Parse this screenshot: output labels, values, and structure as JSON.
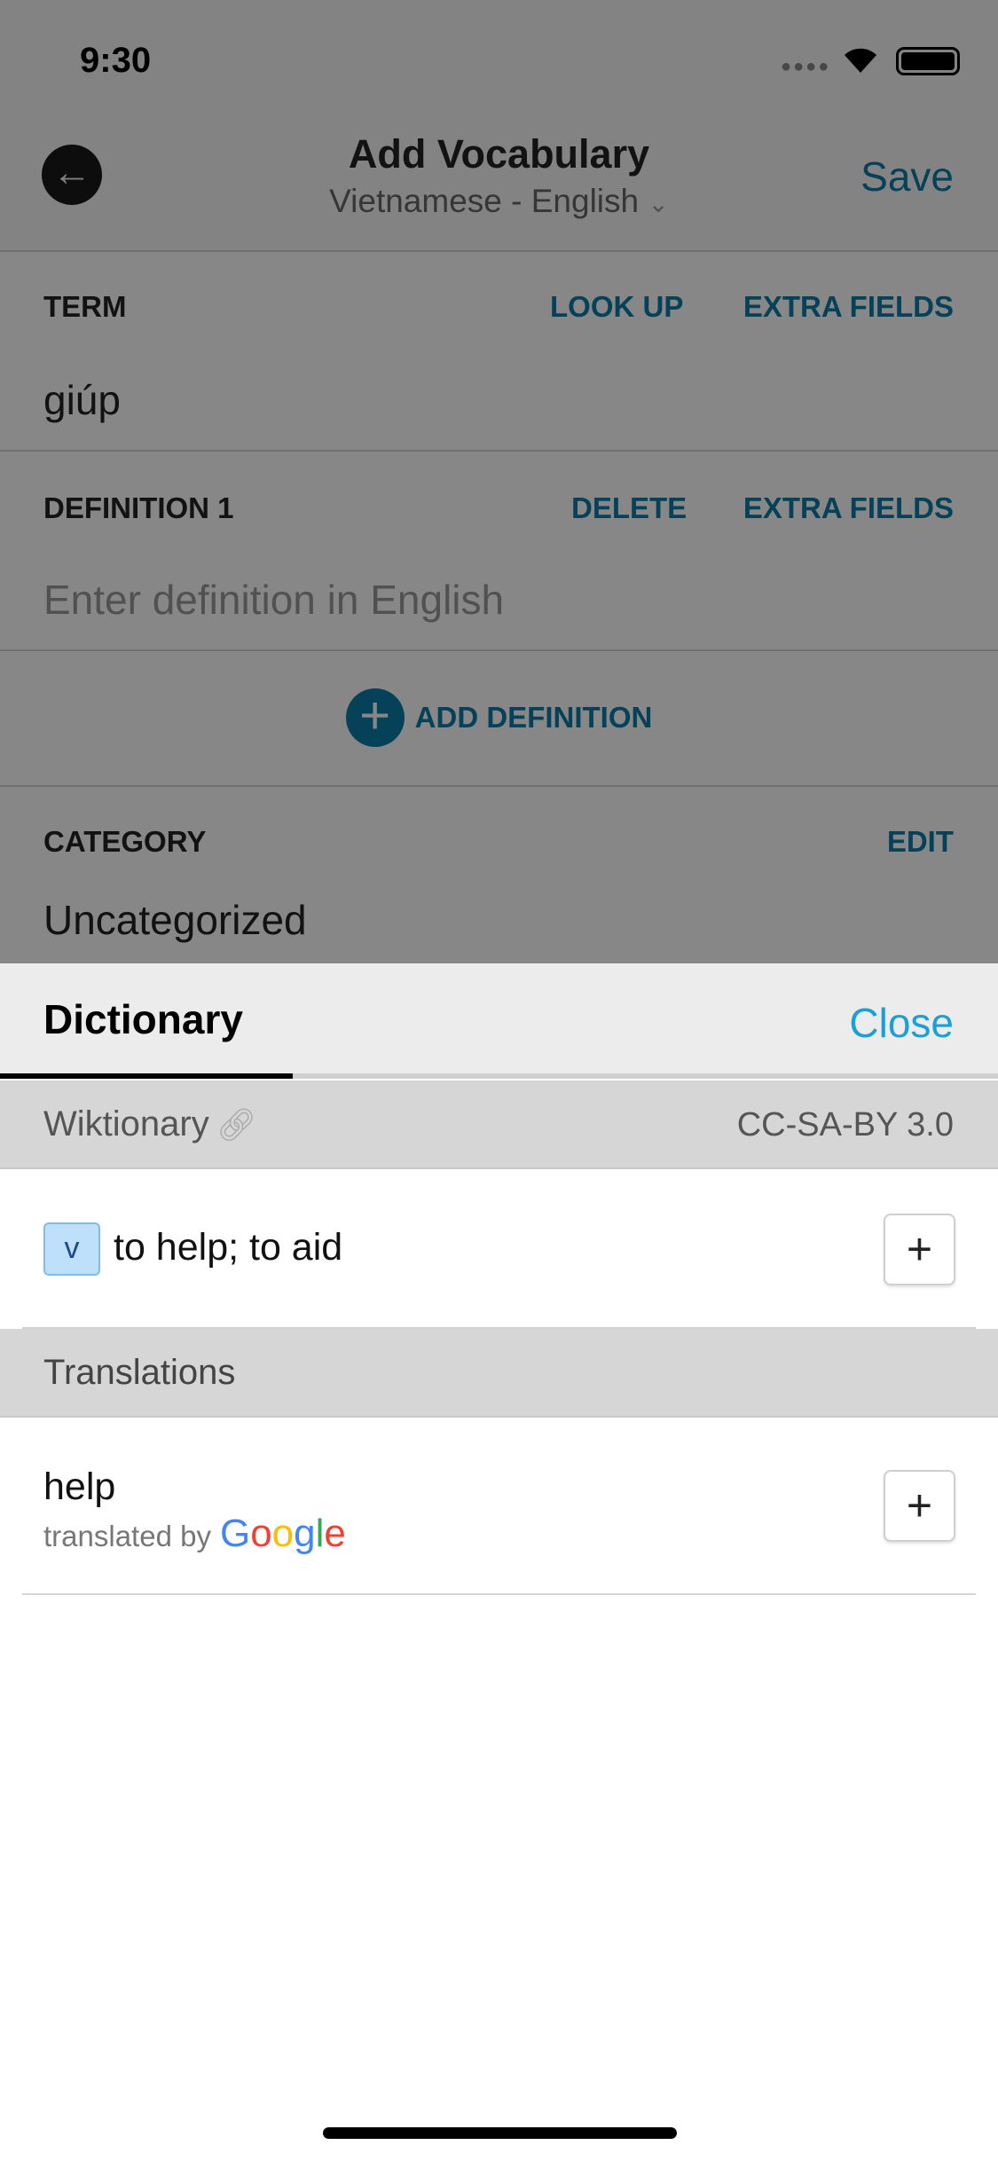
{
  "status": {
    "time": "9:30"
  },
  "nav": {
    "title": "Add Vocabulary",
    "subtitle": "Vietnamese - English",
    "save": "Save"
  },
  "term": {
    "label": "TERM",
    "look_up": "LOOK UP",
    "extra_fields": "EXTRA FIELDS",
    "value": "giúp"
  },
  "definition": {
    "label": "DEFINITION 1",
    "delete": "DELETE",
    "extra_fields": "EXTRA FIELDS",
    "placeholder": "Enter definition in English"
  },
  "add_definition": "ADD DEFINITION",
  "category": {
    "label": "CATEGORY",
    "edit": "EDIT",
    "value": "Uncategorized"
  },
  "sheet": {
    "tab": "Dictionary",
    "close": "Close",
    "source": {
      "name": "Wiktionary",
      "license": "CC-SA-BY 3.0"
    },
    "entries": [
      {
        "pos": "v",
        "text": "to help; to aid"
      }
    ],
    "translations_header": "Translations",
    "translations": [
      {
        "text": "help",
        "credit": "translated by",
        "provider": "Google"
      }
    ]
  },
  "colors": {
    "accent": "#0a7eaa",
    "close": "#1a9fd6",
    "pos_badge": "#bfe0fa"
  }
}
